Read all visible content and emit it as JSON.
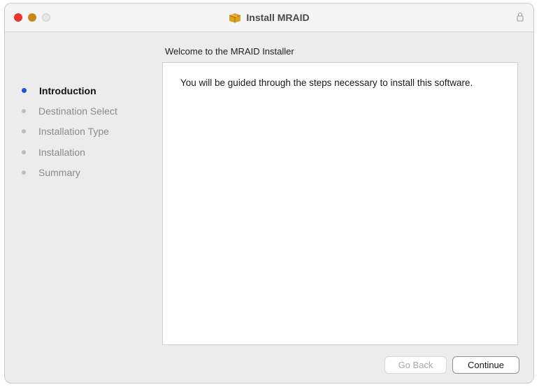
{
  "window": {
    "title": "Install MRAID",
    "title_icon": "package-icon",
    "lock_icon": "lock-icon",
    "traffic_lights": {
      "close_color": "#e8342d",
      "minimize_color": "#c9861a",
      "zoom_color": "#e6e6e6"
    }
  },
  "heading": "Welcome to the MRAID Installer",
  "steps": [
    {
      "label": "Introduction",
      "active": true
    },
    {
      "label": "Destination Select",
      "active": false
    },
    {
      "label": "Installation Type",
      "active": false
    },
    {
      "label": "Installation",
      "active": false
    },
    {
      "label": "Summary",
      "active": false
    }
  ],
  "content": {
    "text": "You will be guided through the steps necessary to install this software."
  },
  "buttons": {
    "back_label": "Go Back",
    "continue_label": "Continue"
  },
  "colors": {
    "accent": "#1a52d9"
  }
}
